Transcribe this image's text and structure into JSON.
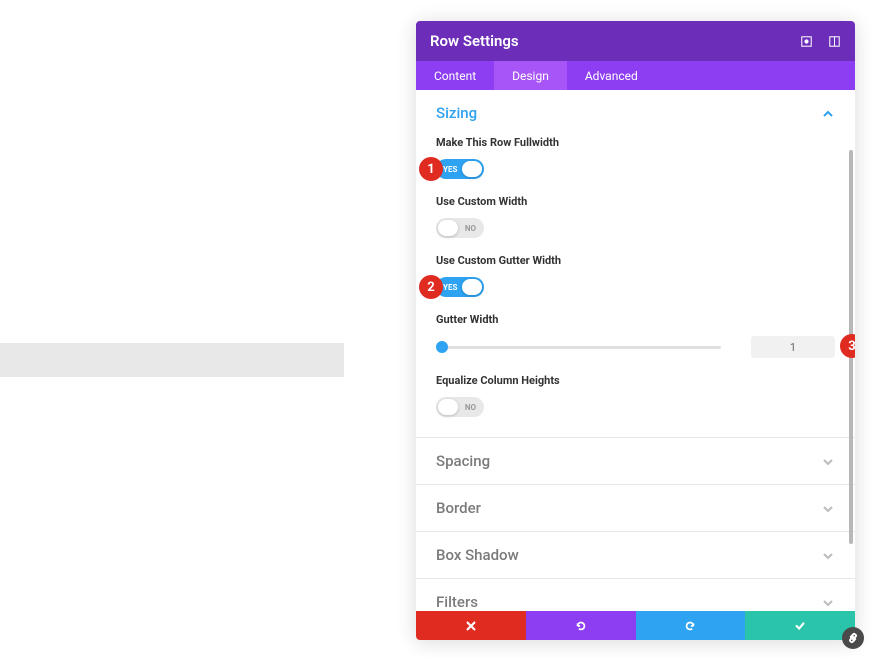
{
  "header": {
    "title": "Row Settings"
  },
  "tabs": [
    {
      "label": "Content"
    },
    {
      "label": "Design"
    },
    {
      "label": "Advanced"
    }
  ],
  "sizing": {
    "title": "Sizing",
    "fullwidth": {
      "label": "Make This Row Fullwidth",
      "value": "YES"
    },
    "customWidth": {
      "label": "Use Custom Width",
      "value": "NO"
    },
    "customGutter": {
      "label": "Use Custom Gutter Width",
      "value": "YES"
    },
    "gutterWidth": {
      "label": "Gutter Width",
      "value": "1"
    },
    "equalize": {
      "label": "Equalize Column Heights",
      "value": "NO"
    }
  },
  "sections": {
    "spacing": "Spacing",
    "border": "Border",
    "boxShadow": "Box Shadow",
    "filters": "Filters"
  },
  "badges": {
    "b1": "1",
    "b2": "2",
    "b3": "3"
  }
}
